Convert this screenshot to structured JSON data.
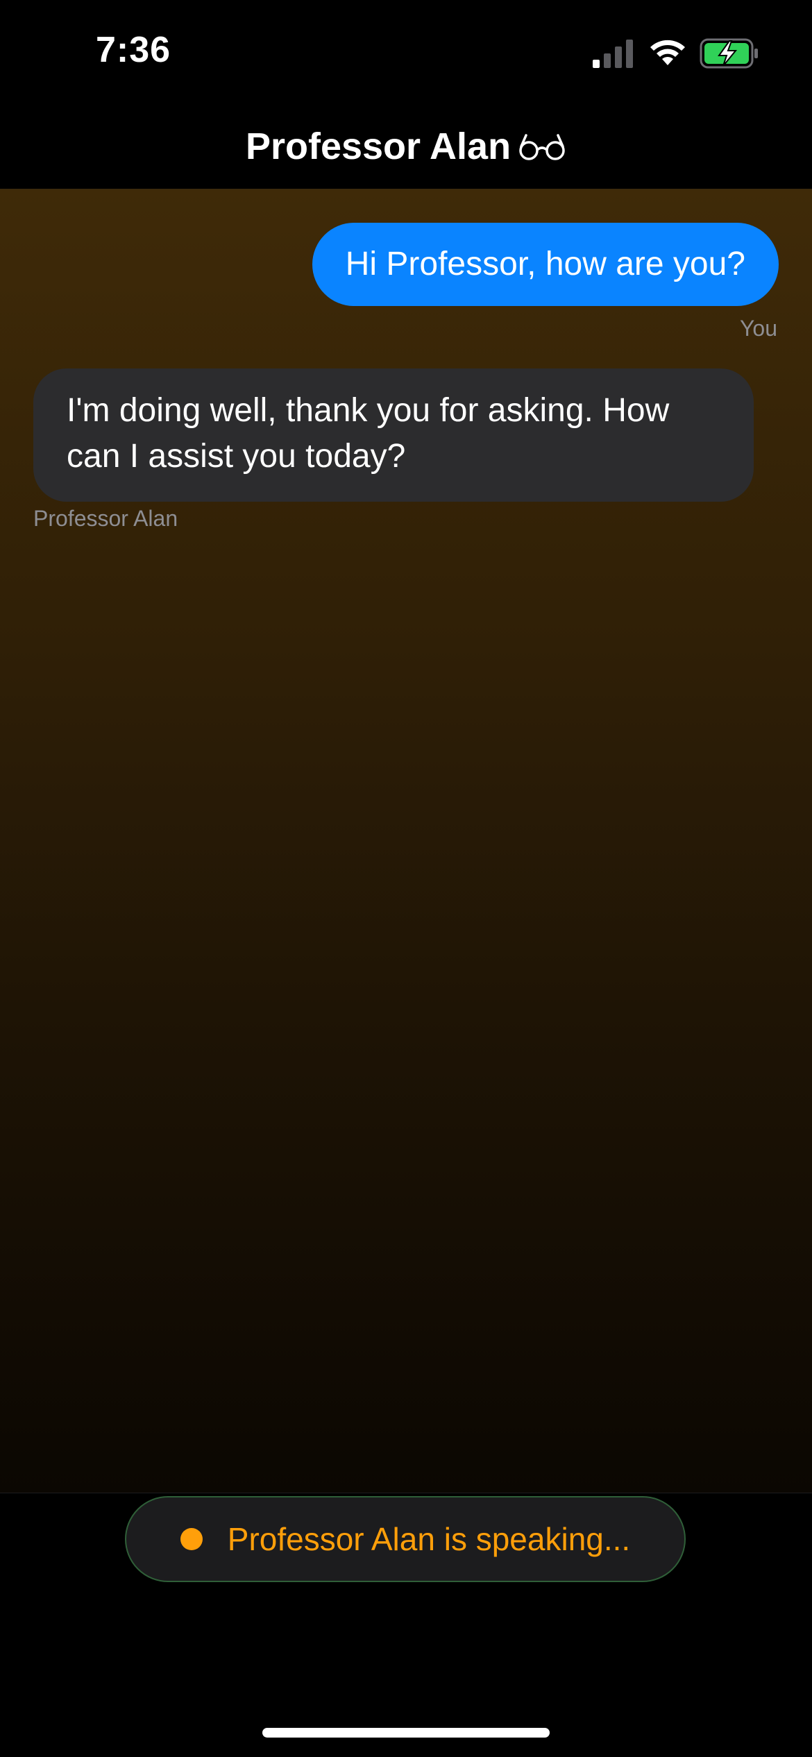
{
  "status_bar": {
    "time": "7:36",
    "signal_icon": "cellular-signal-icon",
    "wifi_icon": "wifi-icon",
    "battery_icon": "battery-charging-icon",
    "battery_color": "#30d158"
  },
  "header": {
    "title": "Professor Alan",
    "title_icon": "glasses-icon"
  },
  "messages": [
    {
      "sender": "You",
      "text": "Hi Professor, how are you?",
      "bubble_color": "#0a84ff"
    },
    {
      "sender": "Professor Alan",
      "text": "I'm doing well, thank you for asking. How can I assist you today?",
      "bubble_color": "#2c2c2e"
    }
  ],
  "status_pill": {
    "text": "Professor Alan is speaking...",
    "accent_color": "#ff9f0a",
    "border_color": "#2f5f38"
  }
}
